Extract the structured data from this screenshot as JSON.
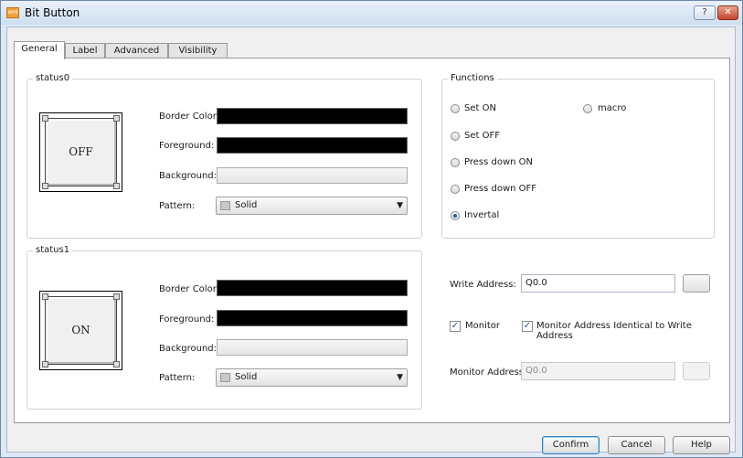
{
  "window": {
    "title": "Bit Button",
    "help_glyph": "?",
    "close_glyph": "✕",
    "app_icon_text": "xml"
  },
  "tabs": [
    {
      "label": "General",
      "active": true
    },
    {
      "label": "Label",
      "active": false
    },
    {
      "label": "Advanced",
      "active": false
    },
    {
      "label": "Visibility",
      "active": false
    }
  ],
  "status0": {
    "title": "status0",
    "preview_text": "OFF",
    "border_color_label": "Border Color:",
    "border_color": "#000000",
    "foreground_label": "Foreground:",
    "foreground": "#000000",
    "background_label": "Background:",
    "pattern_label": "Pattern:",
    "pattern_value": "Solid"
  },
  "status1": {
    "title": "status1",
    "preview_text": "ON",
    "border_color_label": "Border Color:",
    "border_color": "#000000",
    "foreground_label": "Foreground:",
    "foreground": "#000000",
    "background_label": "Background:",
    "pattern_label": "Pattern:",
    "pattern_value": "Solid"
  },
  "functions": {
    "title": "Functions",
    "options": [
      {
        "label": "Set ON",
        "checked": false
      },
      {
        "label": "Set OFF",
        "checked": false
      },
      {
        "label": "Press down ON",
        "checked": false
      },
      {
        "label": "Press down OFF",
        "checked": false
      },
      {
        "label": "Invertal",
        "checked": true
      },
      {
        "label": "macro",
        "checked": false
      }
    ]
  },
  "address": {
    "write_label": "Write Address:",
    "write_value": "Q0.0",
    "monitor_label": "Monitor",
    "monitor_checked": true,
    "identical_label": "Monitor Address Identical to Write Address",
    "identical_checked": true,
    "monitor_address_label": "Monitor Address:",
    "monitor_address_value": "Q0.0"
  },
  "footer": {
    "confirm": "Confirm",
    "cancel": "Cancel",
    "help": "Help"
  }
}
